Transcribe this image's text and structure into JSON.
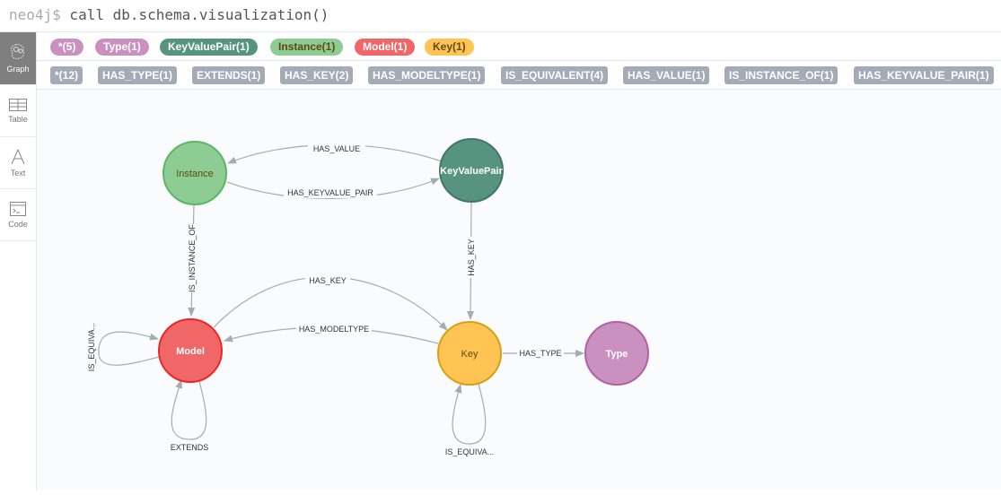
{
  "command": {
    "prompt": "neo4j$",
    "text": " call db.schema.visualization()"
  },
  "sidebar": {
    "items": [
      {
        "label": "Graph",
        "icon": "graph-icon",
        "active": true
      },
      {
        "label": "Table",
        "icon": "table-icon",
        "active": false
      },
      {
        "label": "Text",
        "icon": "text-icon",
        "active": false
      },
      {
        "label": "Code",
        "icon": "code-icon",
        "active": false
      }
    ]
  },
  "labels": [
    {
      "text": "*(5)",
      "bg": "#c990c0",
      "fg": "#ffffff"
    },
    {
      "text": "Type(1)",
      "bg": "#c990c0",
      "fg": "#ffffff"
    },
    {
      "text": "KeyValuePair(1)",
      "bg": "#569480",
      "fg": "#ffffff"
    },
    {
      "text": "Instance(1)",
      "bg": "#8dcc93",
      "fg": "#2a2c34"
    },
    {
      "text": "Model(1)",
      "bg": "#f16667",
      "fg": "#ffffff"
    },
    {
      "text": "Key(1)",
      "bg": "#ffc454",
      "fg": "#2a2c34"
    }
  ],
  "relationship_types": [
    {
      "text": "*(12)"
    },
    {
      "text": "HAS_TYPE(1)"
    },
    {
      "text": "EXTENDS(1)"
    },
    {
      "text": "HAS_KEY(2)"
    },
    {
      "text": "HAS_MODELTYPE(1)"
    },
    {
      "text": "IS_EQUIVALENT(4)"
    },
    {
      "text": "HAS_VALUE(1)"
    },
    {
      "text": "IS_INSTANCE_OF(1)"
    },
    {
      "text": "HAS_KEYVALUE_PAIR(1)"
    }
  ],
  "graph": {
    "nodes": [
      {
        "id": "instance",
        "label": "Instance",
        "fill": "#8dcc93",
        "stroke": "#5db665",
        "text": "#2a2c34"
      },
      {
        "id": "kvp",
        "label": "KeyValuePair",
        "fill": "#569480",
        "stroke": "#447666",
        "text": "#ffffff"
      },
      {
        "id": "model",
        "label": "Model",
        "fill": "#f16667",
        "stroke": "#eb2728",
        "text": "#ffffff"
      },
      {
        "id": "key",
        "label": "Key",
        "fill": "#ffc454",
        "stroke": "#d7a013",
        "text": "#2a2c34"
      },
      {
        "id": "type",
        "label": "Type",
        "fill": "#c990c0",
        "stroke": "#b261a5",
        "text": "#ffffff"
      }
    ],
    "relationships": [
      {
        "label": "HAS_VALUE",
        "from": "kvp",
        "to": "instance"
      },
      {
        "label": "HAS_KEYVALUE_PAIR",
        "from": "instance",
        "to": "kvp"
      },
      {
        "label": "IS_INSTANCE_OF",
        "from": "instance",
        "to": "model"
      },
      {
        "label": "HAS_KEY",
        "from": "kvp",
        "to": "key"
      },
      {
        "label": "HAS_KEY",
        "from": "model",
        "to": "key"
      },
      {
        "label": "HAS_MODELTYPE",
        "from": "key",
        "to": "model"
      },
      {
        "label": "HAS_TYPE",
        "from": "key",
        "to": "type"
      },
      {
        "label": "IS_EQUIVA...",
        "from": "model",
        "to": "model"
      },
      {
        "label": "EXTENDS",
        "from": "model",
        "to": "model"
      },
      {
        "label": "IS_EQUIVA...",
        "from": "key",
        "to": "key"
      }
    ]
  }
}
